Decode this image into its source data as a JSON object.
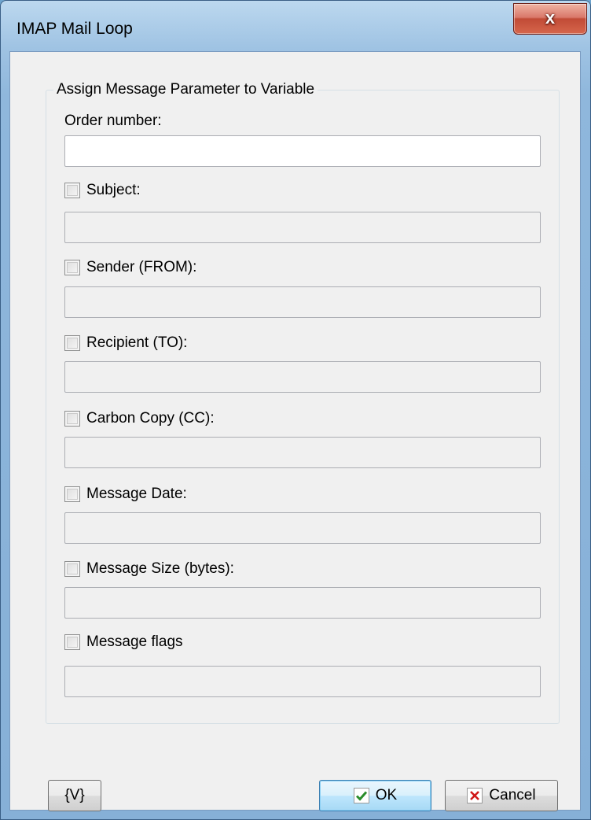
{
  "window": {
    "title": "IMAP Mail Loop",
    "close_glyph": "x"
  },
  "group": {
    "label": "Assign Message Parameter to Variable",
    "order_number_label": "Order number:",
    "order_number_value": "",
    "checks": [
      {
        "label": "Subject:",
        "checked": false,
        "value": ""
      },
      {
        "label": "Sender (FROM):",
        "checked": false,
        "value": ""
      },
      {
        "label": "Recipient (TO):",
        "checked": false,
        "value": ""
      },
      {
        "label": "Carbon Copy (CC):",
        "checked": false,
        "value": ""
      },
      {
        "label": "Message Date:",
        "checked": false,
        "value": ""
      },
      {
        "label": "Message Size (bytes):",
        "checked": false,
        "value": ""
      },
      {
        "label": "Message flags",
        "checked": false,
        "value": ""
      }
    ]
  },
  "buttons": {
    "variables": "{V}",
    "ok": "OK",
    "cancel": "Cancel"
  },
  "icons": {
    "ok": "checkmark-icon",
    "cancel": "x-icon",
    "ok_color": "#2a8c2a",
    "cancel_color": "#d01818"
  }
}
